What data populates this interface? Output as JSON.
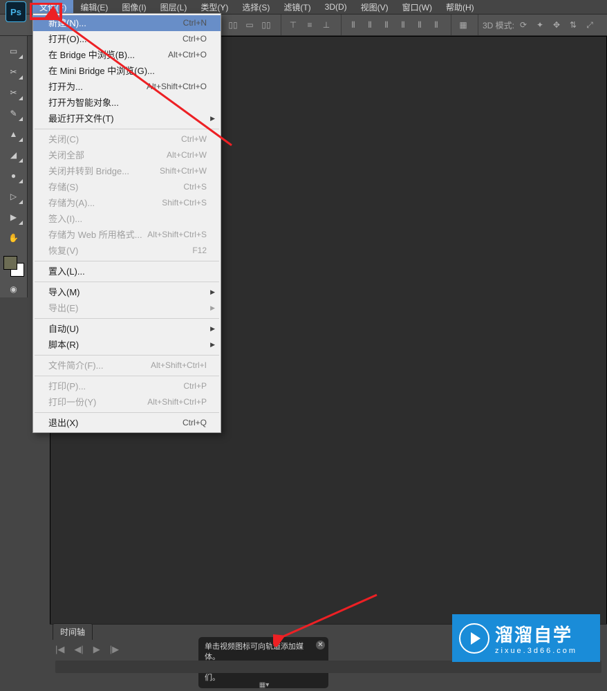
{
  "app": {
    "logo": "Ps"
  },
  "menubar": [
    {
      "id": "file",
      "label": "文件(F)"
    },
    {
      "id": "edit",
      "label": "编辑(E)"
    },
    {
      "id": "image",
      "label": "图像(I)"
    },
    {
      "id": "layer",
      "label": "图层(L)"
    },
    {
      "id": "type",
      "label": "类型(Y)"
    },
    {
      "id": "select",
      "label": "选择(S)"
    },
    {
      "id": "filter",
      "label": "滤镜(T)"
    },
    {
      "id": "3d",
      "label": "3D(D)"
    },
    {
      "id": "view",
      "label": "视图(V)"
    },
    {
      "id": "window",
      "label": "窗口(W)"
    },
    {
      "id": "help",
      "label": "帮助(H)"
    }
  ],
  "options": {
    "mode3d": "3D 模式:"
  },
  "file_menu": {
    "new": {
      "label": "新建(N)...",
      "sc": "Ctrl+N"
    },
    "open": {
      "label": "打开(O)...",
      "sc": "Ctrl+O"
    },
    "browse_bridge": {
      "label": "在 Bridge 中浏览(B)...",
      "sc": "Alt+Ctrl+O"
    },
    "browse_mini": {
      "label": "在 Mini Bridge 中浏览(G)...",
      "sc": ""
    },
    "open_as": {
      "label": "打开为...",
      "sc": "Alt+Shift+Ctrl+O"
    },
    "open_smart": {
      "label": "打开为智能对象...",
      "sc": ""
    },
    "recent": {
      "label": "最近打开文件(T)",
      "sc": ""
    },
    "close": {
      "label": "关闭(C)",
      "sc": "Ctrl+W"
    },
    "close_all": {
      "label": "关闭全部",
      "sc": "Alt+Ctrl+W"
    },
    "close_bridge": {
      "label": "关闭并转到 Bridge...",
      "sc": "Shift+Ctrl+W"
    },
    "save": {
      "label": "存储(S)",
      "sc": "Ctrl+S"
    },
    "save_as": {
      "label": "存储为(A)...",
      "sc": "Shift+Ctrl+S"
    },
    "checkin": {
      "label": "签入(I)...",
      "sc": ""
    },
    "save_web": {
      "label": "存储为 Web 所用格式...",
      "sc": "Alt+Shift+Ctrl+S"
    },
    "revert": {
      "label": "恢复(V)",
      "sc": "F12"
    },
    "place": {
      "label": "置入(L)...",
      "sc": ""
    },
    "import": {
      "label": "导入(M)",
      "sc": ""
    },
    "export": {
      "label": "导出(E)",
      "sc": ""
    },
    "automate": {
      "label": "自动(U)",
      "sc": ""
    },
    "scripts": {
      "label": "脚本(R)",
      "sc": ""
    },
    "info": {
      "label": "文件简介(F)...",
      "sc": "Alt+Shift+Ctrl+I"
    },
    "print": {
      "label": "打印(P)...",
      "sc": "Ctrl+P"
    },
    "print_one": {
      "label": "打印一份(Y)",
      "sc": "Alt+Shift+Ctrl+P"
    },
    "exit": {
      "label": "退出(X)",
      "sc": "Ctrl+Q"
    }
  },
  "timeline": {
    "tab": "时间轴",
    "tooltip_l1": "单击视频图标可向轨道添加媒体。",
    "tooltip_l2": "拖动剪辑可重新排列或组合它们。"
  },
  "watermark": {
    "title": "溜溜自学",
    "sub": "zixue.3d66.com"
  }
}
